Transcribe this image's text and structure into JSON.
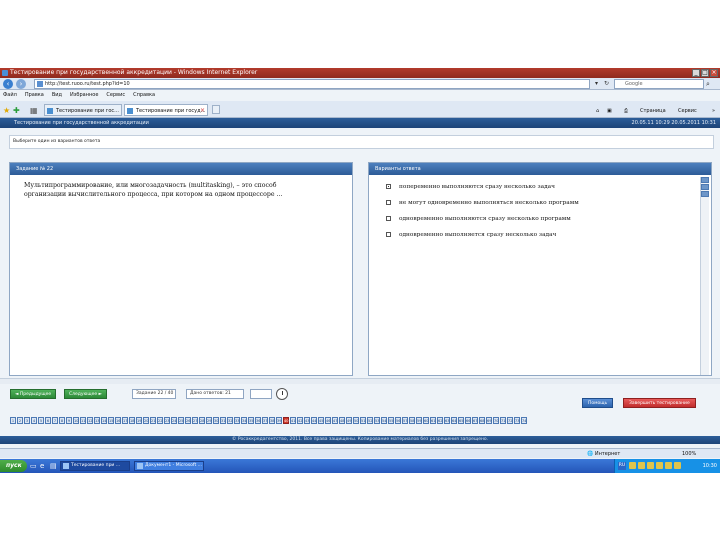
{
  "window": {
    "title": "Тестирование при государственной аккредитации - Windows Internet Explorer",
    "buttons": [
      "_",
      "□",
      "×"
    ]
  },
  "browser": {
    "url": "http://test.ruoo.ru/test.php?id=10",
    "search_placeholder": "Google",
    "menu": [
      "Файл",
      "Правка",
      "Вид",
      "Избранное",
      "Сервис",
      "Справка"
    ],
    "tabs": [
      {
        "label": "Тестирование при гос..."
      },
      {
        "label": "Тестирование при госуд...",
        "close": "×"
      }
    ],
    "command_bar": {
      "page": "Страница",
      "tools": "Сервис"
    },
    "status": {
      "zone": "Интернет",
      "zoom": "100%"
    }
  },
  "app": {
    "header_title": "Тестирование при государственной аккредитации",
    "header_time": "20.05.11 10:29  20.05.2011 10:31",
    "note": "Выберите один из вариантов ответа",
    "question": {
      "header": "Задание № 22",
      "text": "Мультипрограммирование, или многозадачность (multitasking), – это способ организации вычислительного процесса, при котором на одном процессоре ..."
    },
    "answers": {
      "header": "Варианты ответа",
      "options": [
        {
          "label": "попеременно выполняются сразу несколько задач",
          "checked": true
        },
        {
          "label": "не могут одновременно выполняться несколько программ",
          "checked": false
        },
        {
          "label": "одновременно выполняются сразу несколько программ",
          "checked": false
        },
        {
          "label": "одновременно выполняется сразу несколько задач",
          "checked": false
        }
      ]
    },
    "controls": {
      "prev": "◄ Предыдущее",
      "next": "Следующее ►",
      "task_counter": "Задание 22 / 40",
      "answered_counter": "Дано ответов: 21",
      "time_value": "",
      "help": "Помощь",
      "finish": "Завершить тестирование"
    },
    "question_numbers": [
      "1",
      "2",
      "3",
      "4",
      "5",
      "6",
      "7",
      "8",
      "9",
      "10",
      "11",
      "12",
      "13",
      "14",
      "15",
      "16",
      "17",
      "18",
      "19",
      "20",
      "21",
      "22",
      "23",
      "24",
      "25",
      "26",
      "27",
      "28",
      "29",
      "30",
      "31",
      "32",
      "33",
      "34",
      "35",
      "36",
      "37",
      "38",
      "39",
      "40",
      "41",
      "42",
      "43",
      "44",
      "45",
      "46",
      "47",
      "48",
      "49",
      "50",
      "51",
      "52",
      "53",
      "54",
      "55",
      "56",
      "57",
      "58",
      "59",
      "60",
      "61",
      "62",
      "63",
      "64",
      "65",
      "66",
      "67",
      "68",
      "69",
      "70",
      "71",
      "72",
      "73",
      "74"
    ],
    "current_question": "40",
    "footer": "© Росаккредагентство, 2011. Все права защищены. Копирование материалов без разрешения запрещено."
  },
  "taskbar": {
    "start": "пуск",
    "tasks": [
      {
        "label": "Тестирование при ...",
        "active": true
      },
      {
        "label": "Документ1 - Microsoft ...",
        "active": false
      }
    ],
    "lang": "RU",
    "clock": "10:30"
  }
}
